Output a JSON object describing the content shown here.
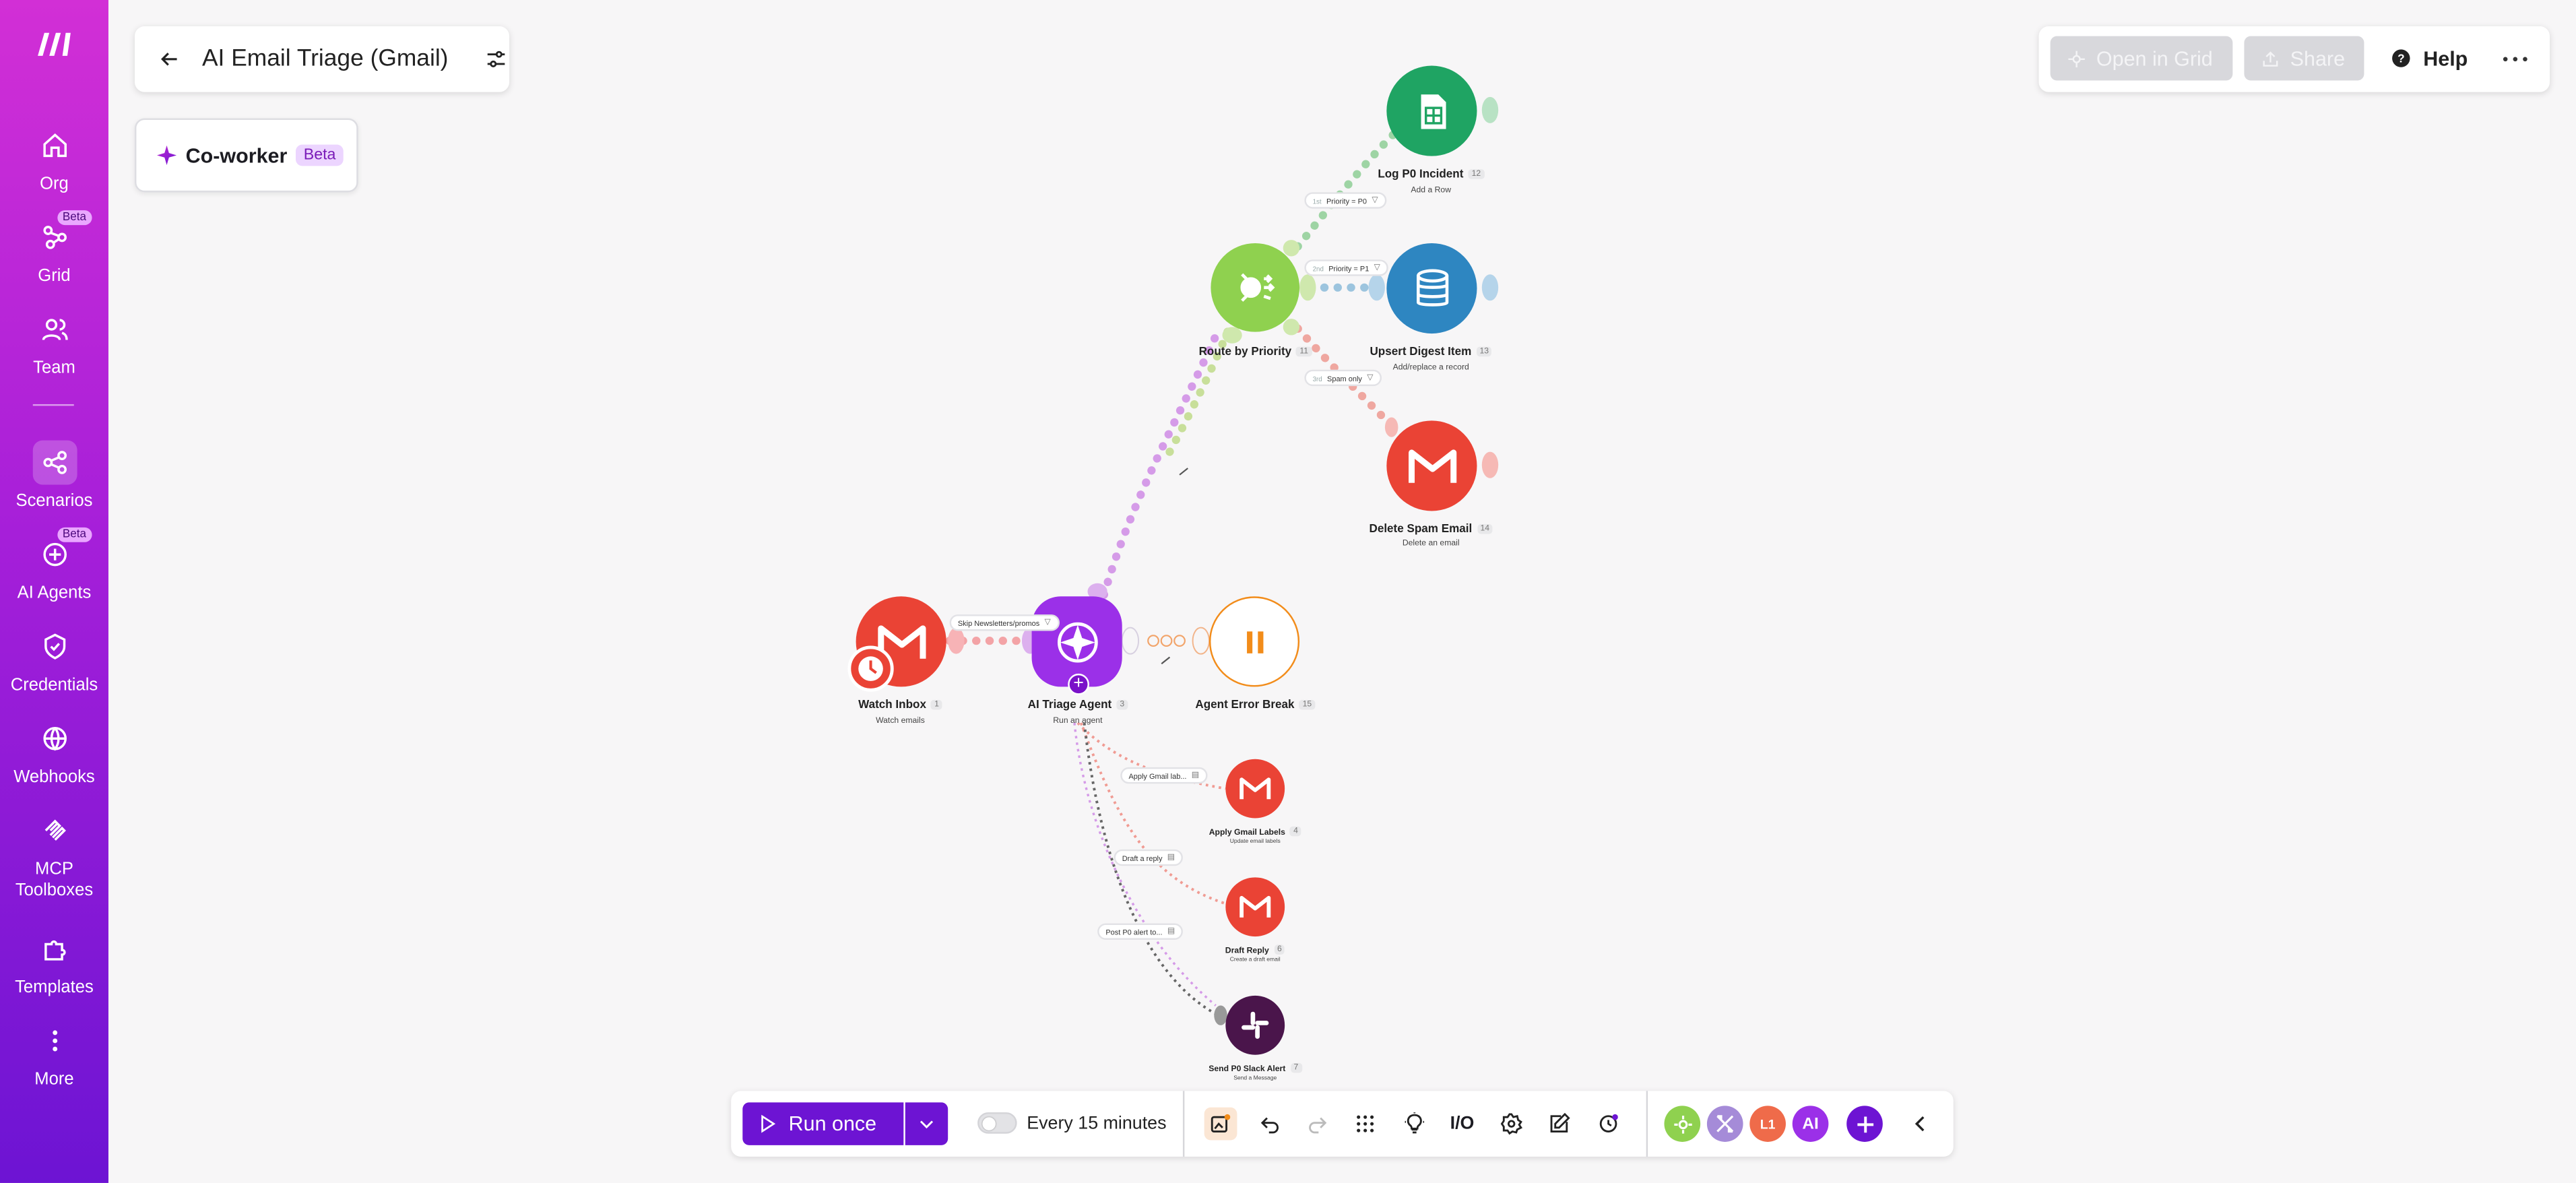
{
  "sidebar": {
    "items": [
      {
        "label": "Org"
      },
      {
        "label": "Grid",
        "badge": "Beta"
      },
      {
        "label": "Team"
      },
      {
        "label": "Scenarios"
      },
      {
        "label": "AI Agents",
        "badge": "Beta"
      },
      {
        "label": "Credentials"
      },
      {
        "label": "Webhooks"
      },
      {
        "label": "MCP Toolboxes"
      },
      {
        "label": "Templates"
      },
      {
        "label": "More"
      }
    ]
  },
  "header": {
    "title": "AI Email Triage (Gmail)",
    "coworker_label": "Co-worker",
    "coworker_badge": "Beta"
  },
  "topbar": {
    "open_grid": "Open in Grid",
    "share": "Share",
    "help": "Help"
  },
  "nodes": {
    "watch_inbox": {
      "label": "Watch Inbox",
      "id": "1",
      "sub": "Watch emails"
    },
    "ai_agent": {
      "label": "AI Triage Agent",
      "id": "3",
      "sub": "Run an agent"
    },
    "error_break": {
      "label": "Agent Error Break",
      "id": "15"
    },
    "router": {
      "label": "Route by Priority",
      "id": "11"
    },
    "log_incident": {
      "label": "Log P0 Incident",
      "id": "12",
      "sub": "Add a Row"
    },
    "upsert": {
      "label": "Upsert Digest Item",
      "id": "13",
      "sub": "Add/replace a record"
    },
    "delete_spam": {
      "label": "Delete Spam Email",
      "id": "14",
      "sub": "Delete an email"
    },
    "apply_labels": {
      "label": "Apply Gmail Labels",
      "id": "4",
      "sub": "Update email labels"
    },
    "draft_reply": {
      "label": "Draft Reply",
      "id": "6",
      "sub": "Create a draft email"
    },
    "slack_alert": {
      "label": "Send P0 Slack Alert",
      "id": "7",
      "sub": "Send a Message"
    }
  },
  "filters": {
    "skip": "Skip Newsletters/promos",
    "p0": "Priority = P0",
    "p1": "Priority = P1",
    "spam": "Spam only",
    "route1": "1st",
    "route2": "2nd",
    "route3": "3rd",
    "tool_labels": "Apply Gmail lab...",
    "tool_draft": "Draft a reply",
    "tool_slack": "Post P0 alert to..."
  },
  "bottom": {
    "run_once": "Run once",
    "schedule": "Every 15 minutes",
    "io_label": "I/O",
    "app_ai": "AI",
    "app_l1": "L1"
  },
  "colors": {
    "accent": "#6d14d3",
    "gmail": "#ea4335",
    "sheets": "#1fa463",
    "datastore": "#2e86c1",
    "router": "#8fd14f",
    "agent": "#9b30e8",
    "slack": "#4a154b",
    "pause": "#f28c1a"
  }
}
